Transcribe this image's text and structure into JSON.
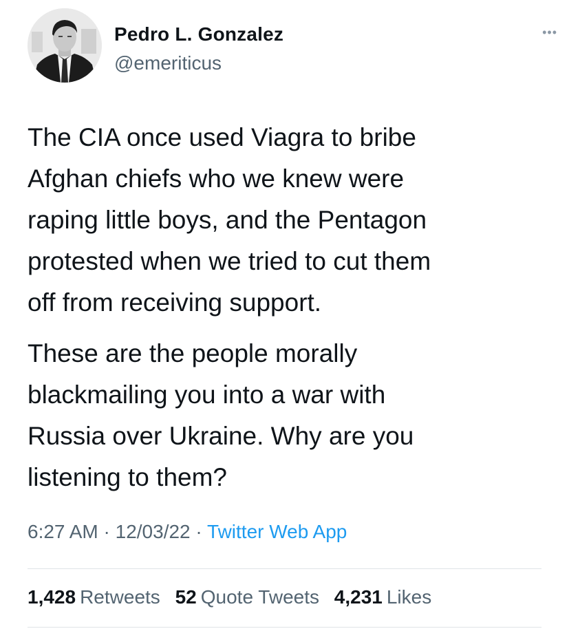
{
  "author": {
    "display_name": "Pedro L. Gonzalez",
    "handle": "@emeriticus"
  },
  "more_icon": "more-horizontal-icon",
  "tweet": {
    "paragraphs": [
      "The CIA once used Viagra to bribe\nAfghan chiefs who we knew were\nraping little boys, and the Pentagon\nprotested when we tried to cut them\noff from receiving support.",
      "These are the people morally\nblackmailing you into a war with\nRussia over Ukraine. Why are you\nlistening to them?"
    ]
  },
  "meta": {
    "time": "6:27 AM",
    "separator": " · ",
    "date": "12/03/22",
    "source": "Twitter Web App"
  },
  "stats": {
    "retweets": {
      "count": "1,428",
      "label": "Retweets"
    },
    "quote_tweets": {
      "count": "52",
      "label": "Quote Tweets"
    },
    "likes": {
      "count": "4,231",
      "label": "Likes"
    }
  },
  "colors": {
    "text": "#0f1419",
    "secondary": "#536471",
    "link": "#1d9bf0",
    "divider": "#dfe3e6"
  }
}
